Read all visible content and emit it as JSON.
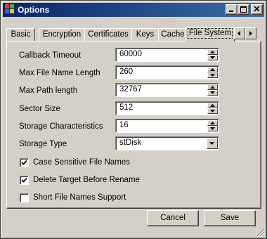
{
  "window": {
    "title": "Options",
    "icon": "app-window-icon",
    "controls": [
      "minimize-icon",
      "maximize-icon",
      "close-icon"
    ]
  },
  "tabs": {
    "items": [
      {
        "label": "Basic"
      },
      {
        "label": "Encryption"
      },
      {
        "label": "Certificates"
      },
      {
        "label": "Keys"
      },
      {
        "label": "Cache"
      },
      {
        "label": "File System"
      }
    ],
    "active": "File System",
    "scroll_icons": [
      "arrow-left-icon",
      "arrow-right-icon"
    ]
  },
  "form": {
    "callback_timeout": {
      "label": "Callback Timeout",
      "value": "60000"
    },
    "max_file_name_length": {
      "label": "Max File Name Length",
      "value": "260"
    },
    "max_path_length": {
      "label": "Max Path length",
      "value": "32767"
    },
    "sector_size": {
      "label": "Sector Size",
      "value": "512"
    },
    "storage_characteristics": {
      "label": "Storage Characteristics",
      "value": "16"
    },
    "storage_type": {
      "label": "Storage Type",
      "value": "stDisk"
    }
  },
  "checkboxes": {
    "case_sensitive": {
      "label": "Case Sensitive File Names",
      "checked": true
    },
    "delete_target": {
      "label": "Delete Target Before Rename",
      "checked": true
    },
    "short_names": {
      "label": "Short File Names Support",
      "checked": false
    }
  },
  "buttons": {
    "cancel": "Cancel",
    "save": "Save"
  },
  "colors": {
    "title_start": "#0a246a",
    "title_end": "#3a6ea5",
    "face": "#d4d0c8"
  }
}
